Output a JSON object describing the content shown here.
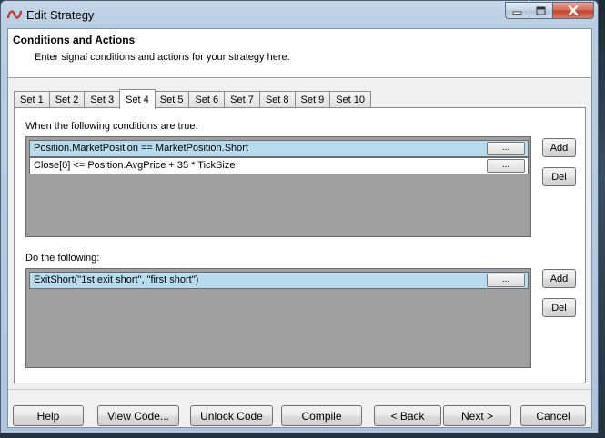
{
  "window": {
    "title": "Edit Strategy",
    "icon": "ninjatrader-logo-icon",
    "controls": [
      "minimize-icon",
      "maximize-icon",
      "close-icon"
    ]
  },
  "header": {
    "title": "Conditions and Actions",
    "subtitle": "Enter signal conditions and actions for your strategy here."
  },
  "tabs": [
    {
      "label": "Set 1"
    },
    {
      "label": "Set 2"
    },
    {
      "label": "Set 3"
    },
    {
      "label": "Set 4"
    },
    {
      "label": "Set 5"
    },
    {
      "label": "Set 6"
    },
    {
      "label": "Set 7"
    },
    {
      "label": "Set 8"
    },
    {
      "label": "Set 9"
    },
    {
      "label": "Set 10"
    }
  ],
  "active_tab": "Set 4",
  "conditions": {
    "label": "When the following conditions are true:",
    "rows": [
      {
        "text": "Position.MarketPosition == MarketPosition.Short",
        "button": "...",
        "selected": true
      },
      {
        "text": "Close[0] <= Position.AvgPrice + 35 * TickSize",
        "button": "...",
        "selected": false
      }
    ],
    "add_label": "Add",
    "del_label": "Del"
  },
  "actions": {
    "label": "Do the following:",
    "rows": [
      {
        "text": "ExitShort(\"1st exit short\", \"first short\")",
        "button": "...",
        "selected": true
      }
    ],
    "add_label": "Add",
    "del_label": "Del"
  },
  "footer": {
    "help": "Help",
    "view_code": "View Code...",
    "unlock_code": "Unlock Code",
    "compile": "Compile",
    "back": "< Back",
    "next": "Next >",
    "cancel": "Cancel"
  },
  "colors": {
    "selected_row": "#b7dcee",
    "grid_background": "#a0a0a0",
    "titlebar": "#b9cde2",
    "close_button": "#c0432b"
  }
}
